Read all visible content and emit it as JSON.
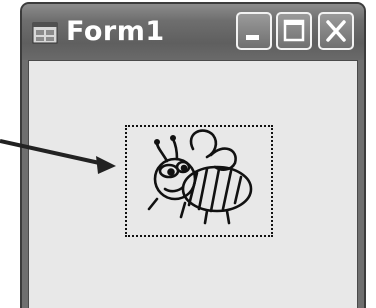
{
  "window": {
    "title": "Form1"
  },
  "icons": {
    "app": "form-window-icon",
    "minimize": "minimize-icon",
    "maximize": "maximize-icon",
    "close": "close-icon",
    "picture": "bee-image",
    "callout": "arrow-pointer"
  },
  "colors": {
    "titlebar": "#6e6e6e",
    "client": "#e8e8e8",
    "title_text": "#ffffff"
  }
}
